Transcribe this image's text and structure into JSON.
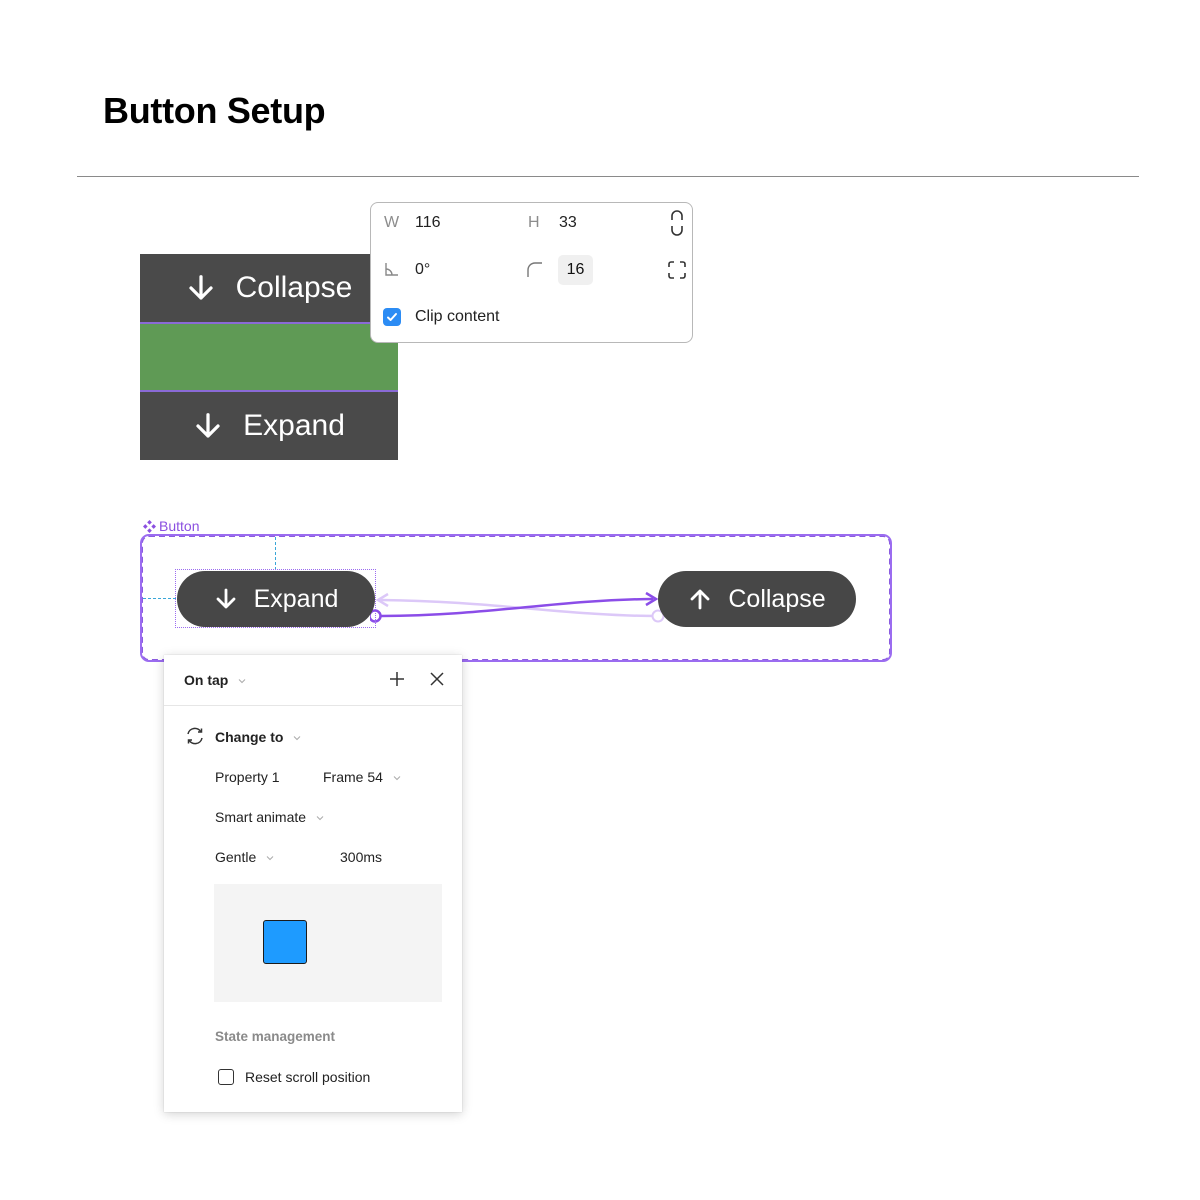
{
  "page": {
    "title": "Button Setup"
  },
  "stack_frame": {
    "rows": [
      {
        "label": "Collapse",
        "icon": "arrow-down-icon",
        "color": "#4a4a4a"
      },
      {
        "label": "",
        "color": "#5f9a55"
      },
      {
        "label": "Expand",
        "icon": "arrow-down-icon",
        "color": "#4a4a4a"
      }
    ]
  },
  "properties": {
    "width_label": "W",
    "width_value": "116",
    "height_label": "H",
    "height_value": "33",
    "rotation_value": "0°",
    "corner_radius_value": "16",
    "clip_content_label": "Clip content",
    "clip_content_checked": true
  },
  "component_set": {
    "label": "Button",
    "accent": "#8b5ce0",
    "variants": [
      {
        "label": "Expand",
        "icon": "arrow-down-icon"
      },
      {
        "label": "Collapse",
        "icon": "arrow-up-icon"
      }
    ]
  },
  "interaction": {
    "trigger": "On tap",
    "action": "Change to",
    "property_label": "Property 1",
    "property_value": "Frame 54",
    "animation": "Smart animate",
    "easing": "Gentle",
    "duration": "300ms",
    "preview_color": "#1e9bff",
    "state_section": "State management",
    "reset_scroll_label": "Reset scroll position",
    "reset_scroll_checked": false
  }
}
